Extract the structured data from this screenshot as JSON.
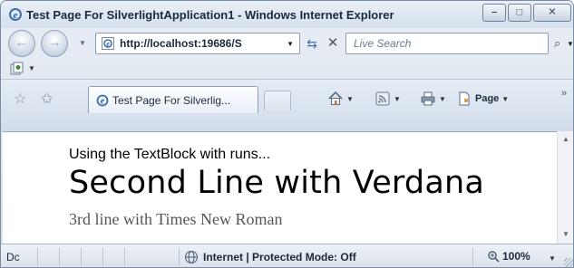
{
  "window": {
    "title": "Test Page For SilverlightApplication1 - Windows Internet Explorer",
    "minimize_glyph": "–",
    "maximize_glyph": "□",
    "close_glyph": "✕"
  },
  "addressbar": {
    "url": "http://localhost:19686/S",
    "dropdown_glyph": "▼",
    "refresh_glyph": "⇆",
    "stop_glyph": "✕"
  },
  "search": {
    "placeholder": "Live Search",
    "go_glyph": "⌕",
    "dropdown_glyph": "▼"
  },
  "nav": {
    "back_glyph": "←",
    "forward_glyph": "→",
    "dropdown_glyph": "▼"
  },
  "tabs": [
    {
      "title": "Test Page For Silverlig..."
    }
  ],
  "commandbar": {
    "page_label": "Page",
    "dropdown_glyph": "▼",
    "chevron_glyph": "»"
  },
  "content": {
    "line1": "Using the TextBlock with runs...",
    "line2": "Second Line with Verdana",
    "line3": "3rd line with Times New Roman"
  },
  "statusbar": {
    "status_text": "Dc",
    "zone_text": "Internet | Protected Mode: Off",
    "zoom_text": "100%",
    "dropdown_glyph": "▼"
  },
  "scroll": {
    "up_glyph": "▲",
    "down_glyph": "▼"
  },
  "colors": {
    "chrome_top": "#eaf0f7",
    "chrome_bottom": "#d5dfeb",
    "border": "#7a8ca3",
    "content_bg": "#ffffff",
    "line3_color": "#555555"
  }
}
